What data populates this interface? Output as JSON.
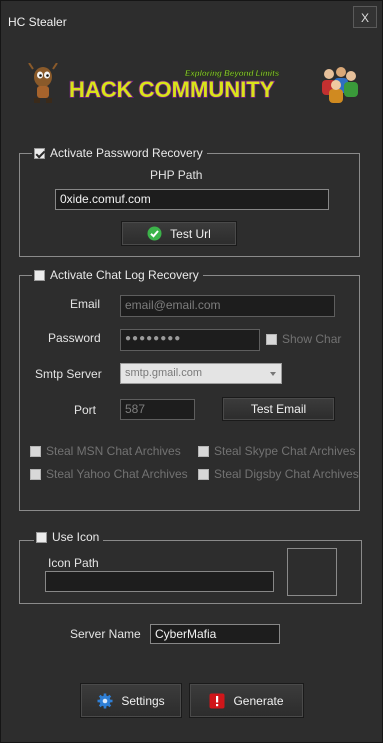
{
  "window": {
    "title": "HC Stealer",
    "close_label": "X"
  },
  "banner": {
    "title": "HACK COMMUNITY",
    "tagline": "Exploring Beyond Limits"
  },
  "password_recovery": {
    "checkbox_label": "Activate Password Recovery",
    "checked": true,
    "php_path_label": "PHP Path",
    "php_path_value": "0xide.comuf.com",
    "test_url_label": "Test Url"
  },
  "chat_log": {
    "checkbox_label": "Activate Chat Log Recovery",
    "checked": false,
    "email_label": "Email",
    "email_placeholder": "email@email.com",
    "password_label": "Password",
    "password_value": "●●●●●●●●",
    "show_char_label": "Show Char",
    "smtp_label": "Smtp Server",
    "smtp_value": "smtp.gmail.com",
    "port_label": "Port",
    "port_value": "587",
    "test_email_label": "Test Email",
    "steal_msn": "Steal MSN Chat Archives",
    "steal_skype": "Steal Skype Chat Archives",
    "steal_yahoo": "Steal Yahoo Chat Archives",
    "steal_digsby": "Steal Digsby Chat Archives"
  },
  "icon": {
    "checkbox_label": "Use Icon",
    "checked": false,
    "icon_path_label": "Icon Path",
    "icon_path_value": ""
  },
  "server": {
    "label": "Server Name",
    "value": "CyberMafia"
  },
  "actions": {
    "settings_label": "Settings",
    "generate_label": "Generate"
  },
  "colors": {
    "background": "#2d2d2d",
    "banner_text": "#d9e31a",
    "banner_outline": "#7a1e8c",
    "tagline": "#9ad43a",
    "generate_icon": "#d0161a",
    "settings_icon": "#2f7fd6",
    "test_url_icon": "#3cb34a"
  },
  "icons": [
    "close-icon",
    "alien-mascot-icon",
    "users-group-icon",
    "check-circle-icon",
    "gear-icon",
    "warning-icon"
  ]
}
